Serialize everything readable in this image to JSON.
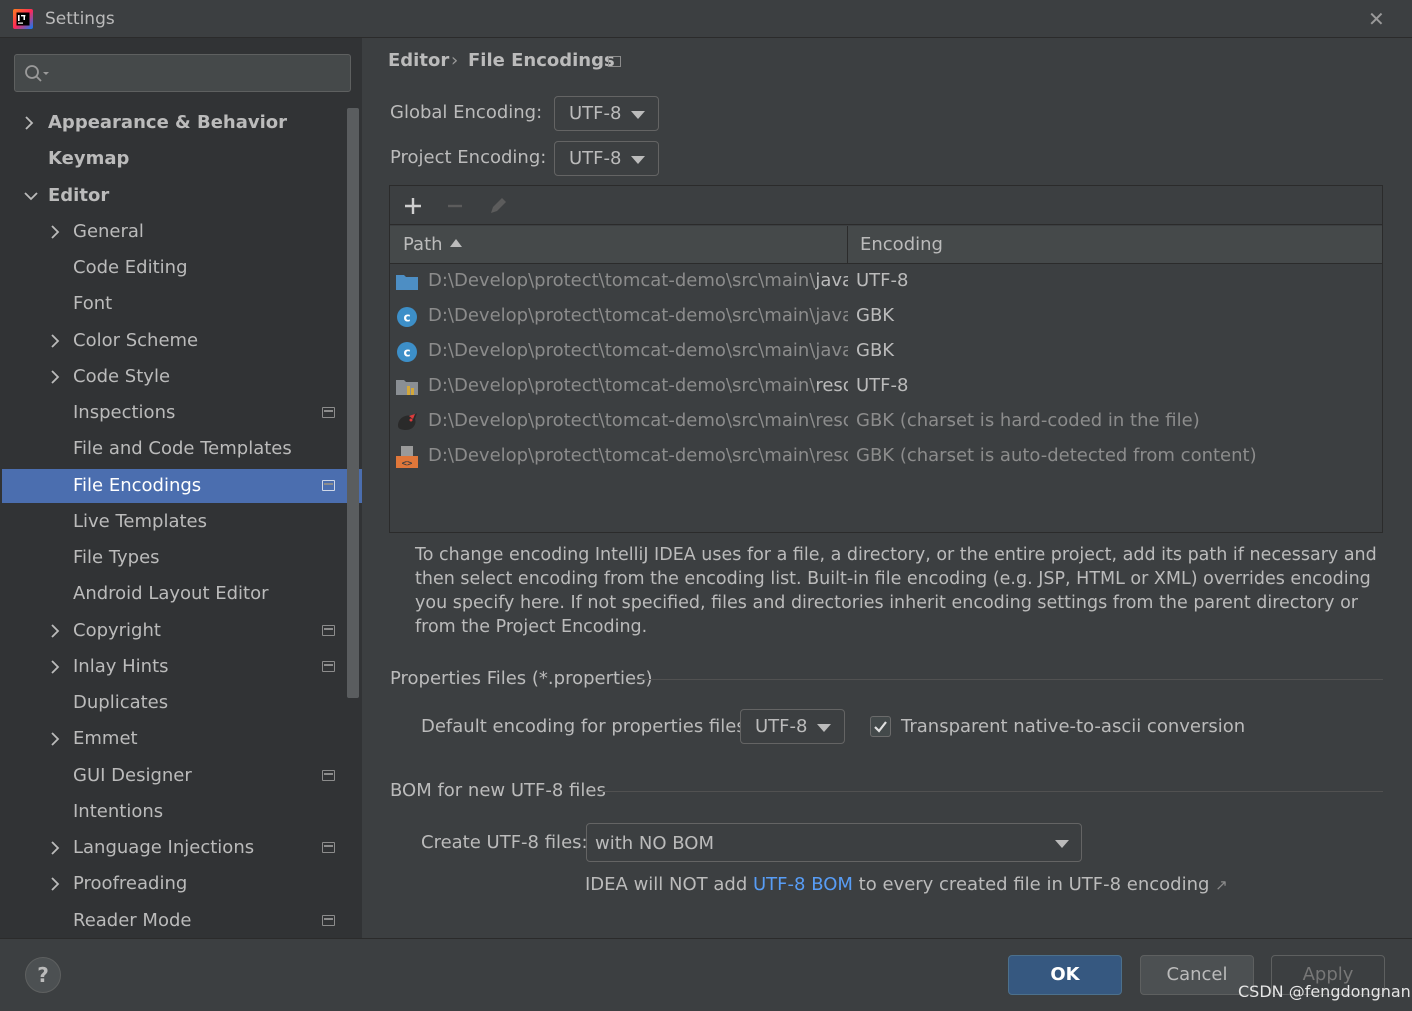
{
  "window": {
    "title": "Settings"
  },
  "search": {
    "placeholder": ""
  },
  "sidebar": {
    "items": [
      {
        "label": "Appearance & Behavior"
      },
      {
        "label": "Keymap"
      },
      {
        "label": "Editor"
      },
      {
        "label": "General"
      },
      {
        "label": "Code Editing"
      },
      {
        "label": "Font"
      },
      {
        "label": "Color Scheme"
      },
      {
        "label": "Code Style"
      },
      {
        "label": "Inspections"
      },
      {
        "label": "File and Code Templates"
      },
      {
        "label": "File Encodings"
      },
      {
        "label": "Live Templates"
      },
      {
        "label": "File Types"
      },
      {
        "label": "Android Layout Editor"
      },
      {
        "label": "Copyright"
      },
      {
        "label": "Inlay Hints"
      },
      {
        "label": "Duplicates"
      },
      {
        "label": "Emmet"
      },
      {
        "label": "GUI Designer"
      },
      {
        "label": "Intentions"
      },
      {
        "label": "Language Injections"
      },
      {
        "label": "Proofreading"
      },
      {
        "label": "Reader Mode"
      }
    ]
  },
  "breadcrumb": {
    "parent": "Editor",
    "separator": "›",
    "current": "File Encodings"
  },
  "global_encoding": {
    "label": "Global Encoding:",
    "value": "UTF-8"
  },
  "project_encoding": {
    "label": "Project Encoding:",
    "value": "UTF-8"
  },
  "table": {
    "columns": [
      "Path",
      "Encoding"
    ],
    "rows": [
      {
        "icon": "folder-icon",
        "path_prefix": "D:\\Develop\\protect\\tomcat-demo\\src\\main\\",
        "path_last": "java",
        "encoding": "UTF-8",
        "muted": false
      },
      {
        "icon": "java-class-icon",
        "path_prefix": "D:\\Develop\\protect\\tomcat-demo\\src\\main\\java\\co",
        "path_last": "",
        "encoding": "GBK",
        "muted": false
      },
      {
        "icon": "java-class-icon",
        "path_prefix": "D:\\Develop\\protect\\tomcat-demo\\src\\main\\java\\co",
        "path_last": "",
        "encoding": "GBK",
        "muted": false
      },
      {
        "icon": "resources-folder-icon",
        "path_prefix": "D:\\Develop\\protect\\tomcat-demo\\src\\main\\",
        "path_last": "resourc",
        "encoding": "UTF-8",
        "muted": false
      },
      {
        "icon": "tomcat-icon",
        "path_prefix": "D:\\Develop\\protect\\tomcat-demo\\src\\main\\resourc",
        "path_last": "",
        "encoding": "GBK (charset is hard-coded in the file)",
        "muted": true
      },
      {
        "icon": "html-file-icon",
        "path_prefix": "D:\\Develop\\protect\\tomcat-demo\\src\\main\\resourc",
        "path_last": "",
        "encoding": "GBK (charset is auto-detected from content)",
        "muted": true
      }
    ]
  },
  "description": "To change encoding IntelliJ IDEA uses for a file, a directory, or the entire project, add its path if necessary and then select encoding from the encoding list. Built-in file encoding (e.g. JSP, HTML or XML) overrides encoding you specify here. If not specified, files and directories inherit encoding settings from the parent directory or from the Project Encoding.",
  "properties": {
    "section_title": "Properties Files (*.properties)",
    "default_label": "Default encoding for properties files:",
    "default_value": "UTF-8",
    "transparent_label": "Transparent native-to-ascii conversion",
    "transparent_checked": true
  },
  "bom": {
    "section_title": "BOM for new UTF-8 files",
    "create_label": "Create UTF-8 files:",
    "create_value": "with NO BOM",
    "info_prefix": "IDEA will NOT add",
    "info_link": "UTF-8 BOM",
    "info_suffix": "to every created file in UTF-8 encoding",
    "info_arrow": "↗"
  },
  "buttons": {
    "help": "?",
    "ok": "OK",
    "cancel": "Cancel",
    "apply": "Apply"
  },
  "watermark": "CSDN @fengdongnan",
  "colors": {
    "accent": "#4b6eaf",
    "ok_button": "#365880",
    "link": "#589df6",
    "background": "#3c3f41",
    "sidebar": "#313335"
  }
}
